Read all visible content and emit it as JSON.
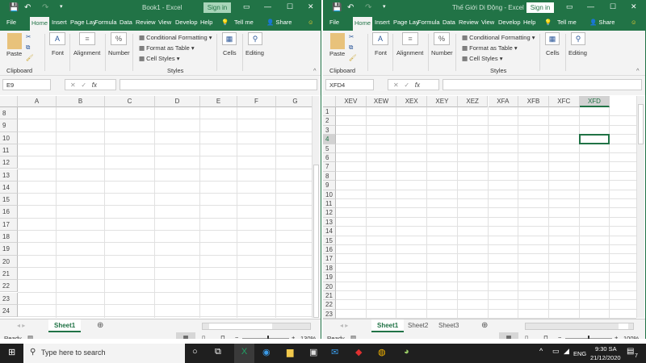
{
  "left": {
    "title": "Book1  -  Excel",
    "namebox": "E9",
    "zoom": "130%",
    "sheets": [
      "Sheet1"
    ],
    "columns": [
      "A",
      "B",
      "C",
      "D",
      "E",
      "F",
      "G"
    ],
    "rows": [
      8,
      9,
      10,
      11,
      12,
      13,
      14,
      15,
      16,
      17,
      18,
      19,
      20,
      21,
      22,
      23,
      24
    ]
  },
  "right": {
    "title": "Thế Giới Di Động  -  Excel",
    "namebox": "XFD4",
    "zoom": "100%",
    "sheets": [
      "Sheet1",
      "Sheet2",
      "Sheet3"
    ],
    "columns": [
      "XEV",
      "XEW",
      "XEX",
      "XEY",
      "XEZ",
      "XFA",
      "XFB",
      "XFC",
      "XFD"
    ],
    "rows": [
      1,
      2,
      3,
      4,
      5,
      6,
      7,
      8,
      9,
      10,
      11,
      12,
      13,
      14,
      15,
      16,
      17,
      18,
      19,
      20,
      21,
      22,
      23
    ],
    "selected_cell": "XFD4"
  },
  "common": {
    "sign_in": "Sign in",
    "tabs": [
      "File",
      "Home",
      "Insert",
      "Page Lay",
      "Formula",
      "Data",
      "Review",
      "View",
      "Develop",
      "Help"
    ],
    "tell_me": "Tell me",
    "share": "Share",
    "ribbon": {
      "paste": "Paste",
      "clipboard": "Clipboard",
      "font": "Font",
      "alignment": "Alignment",
      "number": "Number",
      "conditional_formatting": "Conditional Formatting",
      "format_as_table": "Format as Table",
      "cell_styles": "Cell Styles",
      "styles": "Styles",
      "cells": "Cells",
      "editing": "Editing"
    },
    "fx": "fx",
    "status": "Ready"
  },
  "taskbar": {
    "search_placeholder": "Type here to search",
    "language": "ENG",
    "time": "9:30 SA",
    "date": "21/12/2020",
    "notifications": "7"
  },
  "colors": {
    "excel_green": "#217346",
    "taskbar": "#1f1f1f"
  }
}
